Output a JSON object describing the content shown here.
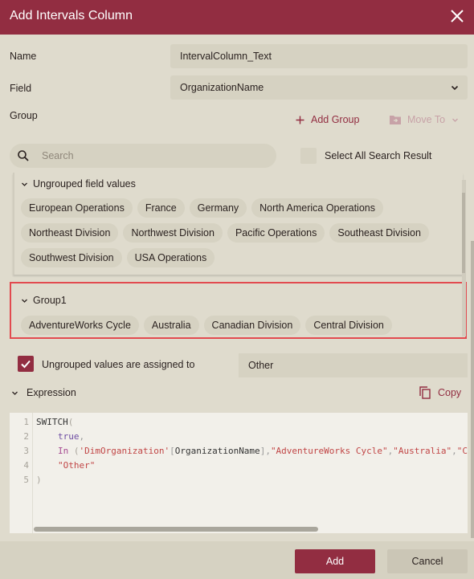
{
  "dialog": {
    "title": "Add Intervals Column",
    "close_icon": "close-icon"
  },
  "form": {
    "name_label": "Name",
    "name_value": "IntervalColumn_Text",
    "field_label": "Field",
    "field_value": "OrganizationName",
    "group_label": "Group"
  },
  "toolbar": {
    "add_group_label": "Add Group",
    "move_to_label": "Move To"
  },
  "search": {
    "placeholder": "Search",
    "select_all_label": "Select All Search Result",
    "select_all_checked": false
  },
  "ungrouped": {
    "title": "Ungrouped field values",
    "items": [
      "European Operations",
      "France",
      "Germany",
      "North America Operations",
      "Northeast Division",
      "Northwest Division",
      "Pacific Operations",
      "Southeast Division",
      "Southwest Division",
      "USA Operations"
    ]
  },
  "group1": {
    "title": "Group1",
    "items": [
      "AdventureWorks Cycle",
      "Australia",
      "Canadian Division",
      "Central Division"
    ]
  },
  "ungrouped_assign": {
    "checked": true,
    "label": "Ungrouped values are assigned to",
    "value": "Other"
  },
  "expression": {
    "title": "Expression",
    "copy_label": "Copy",
    "line_numbers": [
      "1",
      "2",
      "3",
      "4",
      "5"
    ],
    "lines": {
      "l1_fn": "SWITCH",
      "l1_par": "(",
      "l2_kw": "true",
      "l2_comma": ",",
      "l3_in": "In",
      "l3_par": " (",
      "l3_tbl": "'DimOrganization'",
      "l3_col_open": "[",
      "l3_col": "OrganizationName",
      "l3_col_close": "]",
      "l3_rest_1": ",",
      "l3_s1": "\"AdventureWorks Cycle\"",
      "l3_rest_2": ",",
      "l3_s2": "\"Australia\"",
      "l3_rest_3": ",",
      "l3_s3": "\"Canadian Division\"",
      "l4_str": "\"Other\"",
      "l5_par": ")"
    }
  },
  "footer": {
    "add_label": "Add",
    "cancel_label": "Cancel"
  },
  "colors": {
    "accent": "#922d41",
    "highlight_border": "#e24a4f",
    "background": "#dfdbcd"
  }
}
